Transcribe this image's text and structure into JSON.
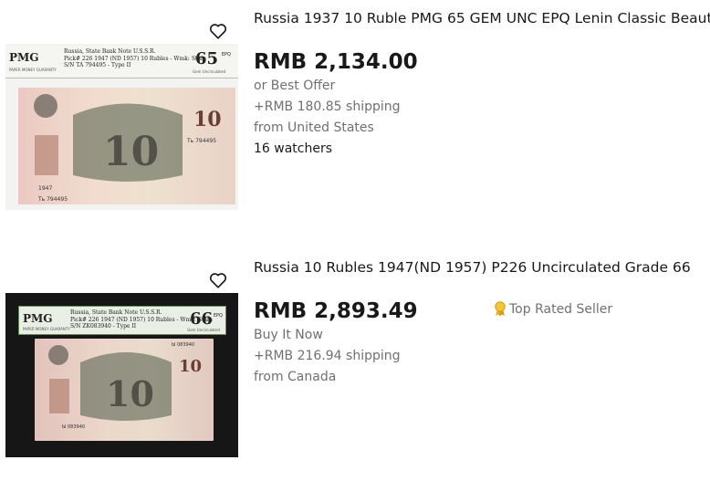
{
  "listings": [
    {
      "title": "Russia 1937 10 Ruble PMG 65 GEM UNC EPQ Lenin Classic Beaut",
      "price": "RMB 2,134.00",
      "buying_format": "or Best Offer",
      "shipping": "+RMB 180.85 shipping",
      "location": "from United States",
      "watchers": "16 watchers",
      "image": {
        "pmg_logo": "PMG",
        "pmg_line1": "Russia, State Bank Note U.S.S.R.",
        "pmg_line2": "Pick# 226  1947 (ND 1957)  10 Rubles - Wmk: Stars",
        "pmg_line3": "S/N TA 794495 - Type II",
        "pmg_guarantee": "PAPER MONEY GUARANTY",
        "grade": "65",
        "epq": "EPQ",
        "grade_desc": "Gem Uncirculated",
        "note_denomination": "10",
        "note_year": "1947",
        "note_serial": "Ть 794495",
        "note_serial_top": "Ть 794495"
      }
    },
    {
      "title": "Russia 10 Rubles 1947(ND 1957) P226 Uncirculated Grade 66",
      "price": "RMB 2,893.49",
      "buying_format": "Buy It Now",
      "shipping": "+RMB 216.94 shipping",
      "location": "from Canada",
      "badge": "Top Rated Seller",
      "image": {
        "pmg_logo": "PMG",
        "pmg_line1": "Russia, State Bank Note U.S.S.R.",
        "pmg_line2": "Pick# 226  1947 (ND 1957)  10 Rubles - Wmk: Stars",
        "pmg_line3": "S/N ZK083940 - Type II",
        "pmg_guarantee": "PAPER MONEY GUARANTY",
        "grade": "66",
        "epq": "EPQ",
        "grade_desc": "Gem Uncirculated",
        "note_denomination": "10",
        "note_serial": "Ы 083940",
        "note_serial_top": "Ы 083940"
      }
    }
  ],
  "icons": {
    "heart": "heart-outline-icon",
    "badge": "ribbon-award-icon"
  },
  "colors": {
    "title": "#191919",
    "secondary_text": "#707070",
    "badge_gold": "#e8b021"
  }
}
